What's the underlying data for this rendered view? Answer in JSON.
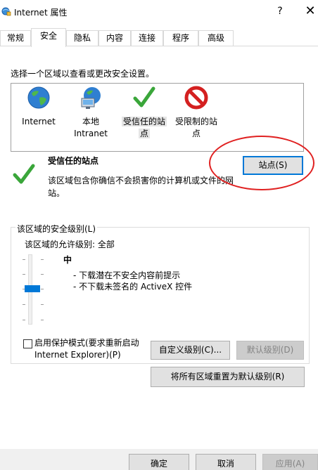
{
  "window": {
    "title": "Internet 属性",
    "help_glyph": "?",
    "close_glyph": "✕"
  },
  "tabs": [
    {
      "label": "常规"
    },
    {
      "label": "安全"
    },
    {
      "label": "隐私"
    },
    {
      "label": "内容"
    },
    {
      "label": "连接"
    },
    {
      "label": "程序"
    },
    {
      "label": "高级"
    }
  ],
  "security": {
    "instruction": "选择一个区域以查看或更改安全设置。",
    "zones": [
      {
        "line1": "Internet",
        "line2": "",
        "icon": "globe-icon"
      },
      {
        "line1": "本地",
        "line2": "Intranet",
        "icon": "intranet-icon"
      },
      {
        "line1": "受信任的站",
        "line2": "点",
        "icon": "check-icon"
      },
      {
        "line1": "受限制的站",
        "line2": "点",
        "icon": "restricted-icon"
      }
    ],
    "selected_zone": "受信任的站点",
    "selected_zone_desc": "该区域包含你确信不会损害你的计算机或文件的网站。",
    "sites_button": "站点(S)",
    "level_group_label": "该区域的安全级别(L)",
    "allowed_levels": "该区域的允许级别: 全部",
    "level_name": "中",
    "level_desc_1": "- 下载潜在不安全内容前提示",
    "level_desc_2": "- 不下载未签名的 ActiveX 控件",
    "protected_mode_label_1": "启用保护模式(要求重新启动",
    "protected_mode_label_2": "Internet Explorer)(P)",
    "protected_mode_checked": false,
    "custom_level_button": "自定义级别(C)...",
    "default_level_button": "默认级别(D)",
    "reset_all_button": "将所有区域重置为默认级别(R)"
  },
  "footer": {
    "ok": "确定",
    "cancel": "取消",
    "apply": "应用(A)"
  },
  "colors": {
    "accent": "#0078d7",
    "highlight_ellipse": "#e02020",
    "check_green": "#3aa63a",
    "restricted_red": "#d42020"
  }
}
